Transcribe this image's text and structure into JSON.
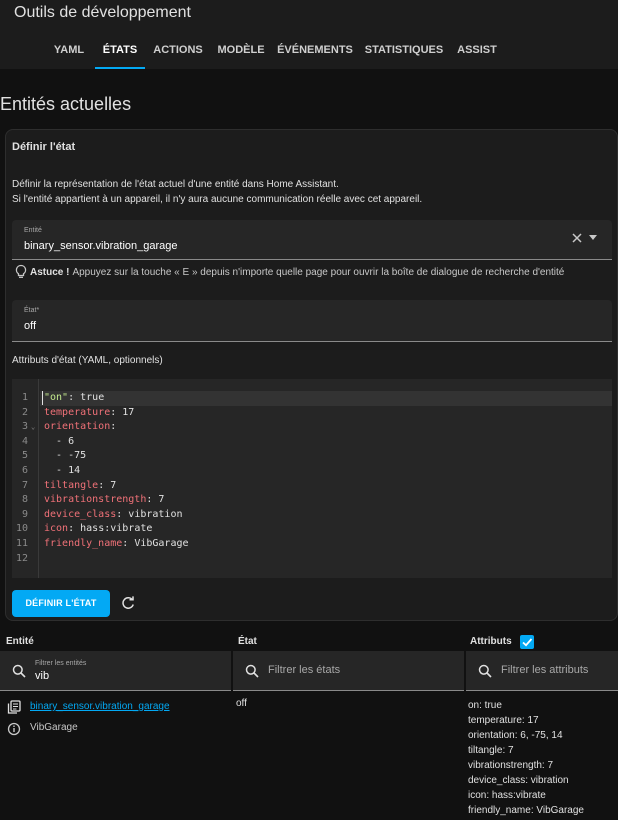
{
  "app": {
    "title": "Outils de développement"
  },
  "tabs": [
    {
      "label": "YAML"
    },
    {
      "label": "ÉTATS"
    },
    {
      "label": "ACTIONS"
    },
    {
      "label": "MODÈLE"
    },
    {
      "label": "ÉVÉNEMENTS"
    },
    {
      "label": "STATISTIQUES"
    },
    {
      "label": "ASSIST"
    }
  ],
  "page_title": "Entités actuelles",
  "set_state": {
    "title": "Définir l'état",
    "description_1": "Définir la représentation de l'état actuel d'une entité dans Home Assistant.",
    "description_2": "Si l'entité appartient à un appareil, il n'y aura aucune communication réelle avec cet appareil.",
    "entity_label": "Entité",
    "entity_value": "binary_sensor.vibration_garage",
    "tip_bold": "Astuce !",
    "tip_text": "Appuyez sur la touche « E » depuis n'importe quelle page pour ouvrir la boîte de dialogue de recherche d'entité",
    "state_label": "État*",
    "state_value": "off",
    "attributes_label": "Attributs d'état (YAML, optionnels)",
    "yaml_lines": [
      {
        "num": "1",
        "key": "\"on\"",
        "value": " true"
      },
      {
        "num": "2",
        "key": "temperature",
        "value": " 17"
      },
      {
        "num": "3",
        "key": "orientation",
        "value": ""
      },
      {
        "num": "4",
        "key": "",
        "value": "  - 6"
      },
      {
        "num": "5",
        "key": "",
        "value": "  - -75"
      },
      {
        "num": "6",
        "key": "",
        "value": "  - 14"
      },
      {
        "num": "7",
        "key": "tiltangle",
        "value": " 7"
      },
      {
        "num": "8",
        "key": "vibrationstrength",
        "value": " 7"
      },
      {
        "num": "9",
        "key": "device_class",
        "value": " vibration"
      },
      {
        "num": "10",
        "key": "icon",
        "value": " hass:vibrate"
      },
      {
        "num": "11",
        "key": "friendly_name",
        "value": " VibGarage"
      },
      {
        "num": "12",
        "key": "",
        "value": ""
      }
    ],
    "button_label": "DÉFINIR L'ÉTAT"
  },
  "table": {
    "col_entity": "Entité",
    "col_state": "État",
    "col_attributes": "Attributs",
    "filter_entities_label": "Filtrer les entités",
    "filter_entities_value": "vib",
    "filter_states_placeholder": "Filtrer les états",
    "filter_attributes_placeholder": "Filtrer les attributs",
    "rows": [
      {
        "entity_id": "binary_sensor.vibration_garage",
        "friendly_name": "VibGarage",
        "state": "off",
        "attributes": [
          "on: true",
          "temperature: 17",
          "orientation: 6, -75, 14",
          "tiltangle: 7",
          "vibrationstrength: 7",
          "device_class: vibration",
          "icon: hass:vibrate",
          "friendly_name: VibGarage"
        ]
      }
    ]
  },
  "colors": {
    "accent": "#03a9f4",
    "background": "#111111",
    "card": "#1c1c1c",
    "yaml_key": "#f07178"
  }
}
